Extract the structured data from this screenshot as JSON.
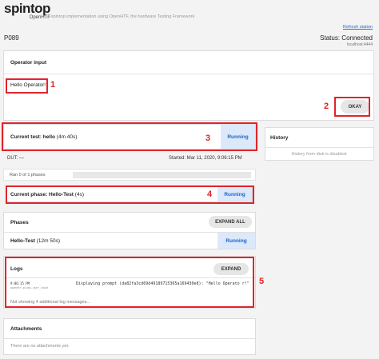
{
  "header": {
    "logo_text": "spintop",
    "logo_sub": "OpenHTF",
    "tagline": "A spintop implementation using OpenHTF, the hardware Testing Framework",
    "refresh_label": "Refresh station",
    "station_id": "P089",
    "status_label": "Status: Connected",
    "host": "localhost:4444"
  },
  "operator_input": {
    "title": "Operator input",
    "prompt": "Hello Operator!",
    "okay_label": "OKAY"
  },
  "current_test": {
    "label": "Current test: hello",
    "duration": "(4m 40s)",
    "status": "Running",
    "dut": "DUT: —",
    "started": "Started: Mar 11, 2020, 9:06:15 PM",
    "phases_progress": "Ran 0 of 1 phases",
    "progress": 0
  },
  "current_phase": {
    "label": "Current phase: Hello-Test",
    "duration": "(4s)",
    "status": "Running"
  },
  "history": {
    "title": "History",
    "note": "History from disk is disabled."
  },
  "phases": {
    "title": "Phases",
    "expand_label": "EXPAND ALL",
    "items": [
      {
        "name": "Hello-Test",
        "duration": "(12m 50s)",
        "status": "Running"
      }
    ]
  },
  "logs": {
    "title": "Logs",
    "expand_label": "EXPAND",
    "entries": [
      {
        "time": "9:06:15 PM",
        "source": "openhtf.plugs.user_input",
        "message": "Displaying prompt (da82fa3cd69d49189715365a169430e8): \"Hello Operato r!\""
      }
    ],
    "more_note": "Not showing 4 additional log messages..."
  },
  "attachments": {
    "title": "Attachments",
    "note": "There are no attachments yet."
  },
  "annotations": [
    "1",
    "2",
    "3",
    "4",
    "5"
  ],
  "colors": {
    "annotation_red": "#e0242b",
    "running_bg": "#dbe9fb",
    "running_text": "#1f63c5",
    "link_blue": "#2b6cc4"
  }
}
